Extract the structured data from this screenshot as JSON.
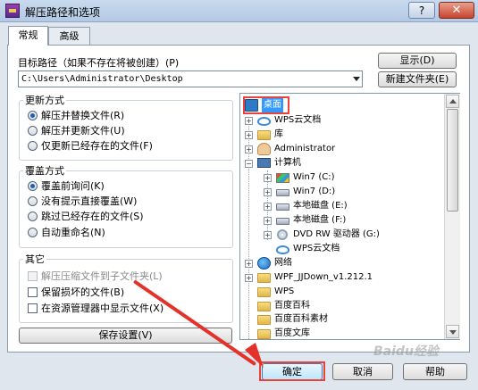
{
  "window": {
    "title": "解压路径和选项",
    "help_label": "?",
    "close_label": "✕"
  },
  "tabs": [
    {
      "label": "常规"
    },
    {
      "label": "高级"
    }
  ],
  "target": {
    "label": "目标路径（如果不存在将被创建）(P)",
    "path": "C:\\Users\\Administrator\\Desktop",
    "show_button": "显示(D)",
    "new_folder_button": "新建文件夹(E)"
  },
  "update_mode": {
    "title": "更新方式",
    "options": [
      {
        "label": "解压并替换文件(R)",
        "checked": true
      },
      {
        "label": "解压并更新文件(U)",
        "checked": false
      },
      {
        "label": "仅更新已经存在的文件(F)",
        "checked": false
      }
    ]
  },
  "overwrite_mode": {
    "title": "覆盖方式",
    "options": [
      {
        "label": "覆盖前询问(K)",
        "checked": true
      },
      {
        "label": "没有提示直接覆盖(W)",
        "checked": false
      },
      {
        "label": "跳过已经存在的文件(S)",
        "checked": false
      },
      {
        "label": "自动重命名(N)",
        "checked": false
      }
    ]
  },
  "other": {
    "title": "其它",
    "options": [
      {
        "label": "解压压缩文件到子文件夹(L)",
        "disabled": true
      },
      {
        "label": "保留损坏的文件(B)",
        "disabled": false
      },
      {
        "label": "在资源管理器中显示文件(X)",
        "disabled": false
      }
    ]
  },
  "save_settings_button": "保存设置(V)",
  "tree": {
    "selected": "桌面",
    "items": [
      {
        "label": "桌面",
        "icon": "desktop-icon"
      },
      {
        "label": "WPS云文档",
        "icon": "cloud-icon"
      },
      {
        "label": "库",
        "icon": "folder-icon"
      },
      {
        "label": "Administrator",
        "icon": "user-icon"
      },
      {
        "label": "计算机",
        "icon": "computer-icon"
      },
      {
        "label": "Win7 (C:)",
        "icon": "windows-drive-icon"
      },
      {
        "label": "Win7 (D:)",
        "icon": "drive-icon"
      },
      {
        "label": "本地磁盘 (E:)",
        "icon": "drive-icon"
      },
      {
        "label": "本地磁盘 (F:)",
        "icon": "drive-icon"
      },
      {
        "label": "DVD RW 驱动器 (G:)",
        "icon": "dvd-icon"
      },
      {
        "label": "WPS云文档",
        "icon": "cloud-icon"
      },
      {
        "label": "网络",
        "icon": "network-icon"
      },
      {
        "label": "WPF_JJDown_v1.212.1",
        "icon": "folder-icon"
      },
      {
        "label": "WPS",
        "icon": "folder-icon"
      },
      {
        "label": "百度百科",
        "icon": "folder-icon"
      },
      {
        "label": "百度百科素材",
        "icon": "folder-icon"
      },
      {
        "label": "百度文库",
        "icon": "folder-icon"
      },
      {
        "label": "",
        "icon": "folder-icon"
      }
    ]
  },
  "footer": {
    "ok": "确定",
    "cancel": "取消",
    "help": "帮助"
  },
  "watermark": "Baidu经验",
  "annotation_color": "#e4322b"
}
